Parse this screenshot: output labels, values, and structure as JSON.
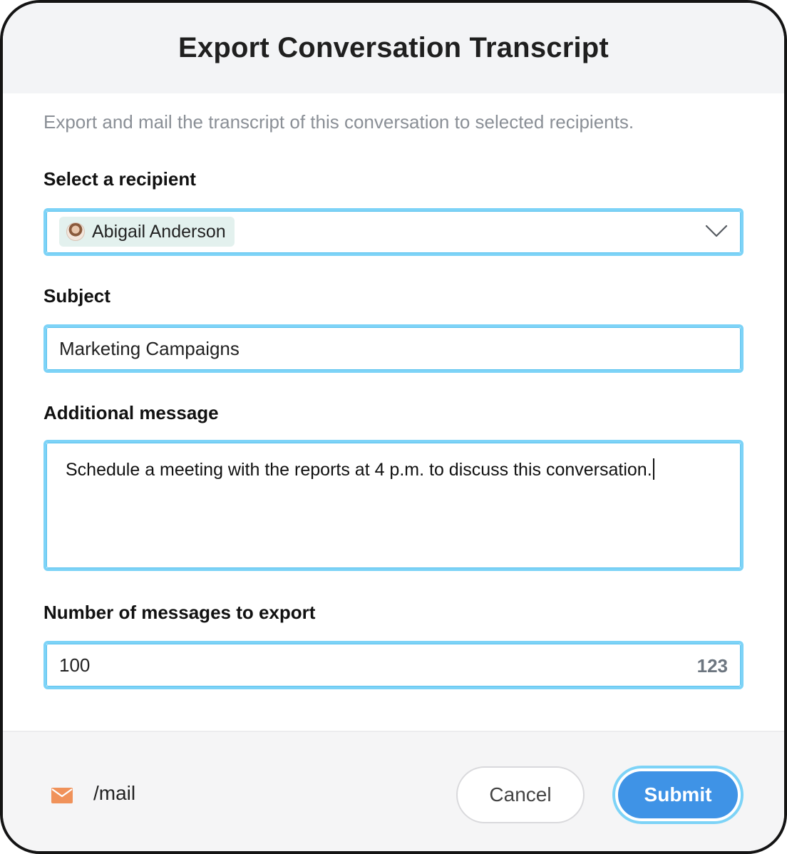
{
  "dialog": {
    "title": "Export Conversation Transcript",
    "description": "Export and mail the transcript of this conversation to selected recipients."
  },
  "recipient": {
    "label": "Select a recipient",
    "selected": "Abigail Anderson",
    "icon": "chevron-down-icon"
  },
  "subject": {
    "label": "Subject",
    "value": "Marketing Campaigns"
  },
  "message": {
    "label": "Additional message",
    "value": "Schedule a meeting with the reports at 4 p.m. to discuss this conversation."
  },
  "count": {
    "label": "Number of messages to export",
    "value": "100",
    "unit_hint": "123"
  },
  "footer": {
    "command_icon": "mail-icon",
    "command": "/mail",
    "cancel_label": "Cancel",
    "submit_label": "Submit"
  },
  "colors": {
    "focus_border": "#7dd3f7",
    "submit": "#3f93e6",
    "mail_icon": "#f0925a",
    "header_bg": "#f3f4f6"
  }
}
